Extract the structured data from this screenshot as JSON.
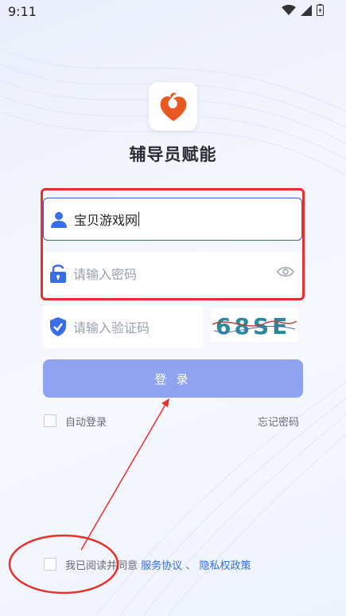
{
  "status_bar": {
    "time": "9:11",
    "icons": [
      "wifi-icon",
      "signal-icon",
      "battery-icon"
    ]
  },
  "app": {
    "logo": "app-logo",
    "title": "辅导员赋能"
  },
  "form": {
    "username_value": "宝贝游戏网",
    "password_placeholder": "请输入密码",
    "captcha_placeholder": "请输入验证码",
    "captcha_text": "68SE",
    "login_label": "登 录",
    "auto_login_label": "自动登录",
    "forgot_password_label": "忘记密码"
  },
  "agreement": {
    "prefix": "我已阅读并同意",
    "service_link": "服务协议",
    "separator": "、",
    "privacy_link": "隐私权政策"
  },
  "colors": {
    "accent": "#3a5fd8",
    "button": "#8fa3f0",
    "link": "#2f6ee0",
    "annotation": "#e8302a",
    "logo": "#e8581f"
  }
}
